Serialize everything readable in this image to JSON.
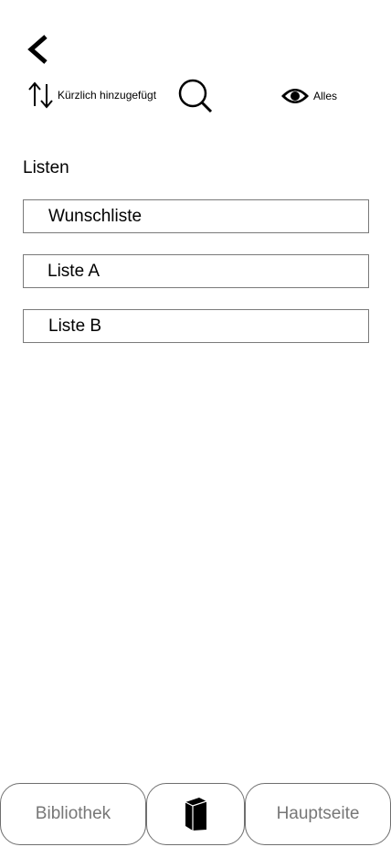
{
  "toolbar": {
    "sort_label": "Kürzlich hinzugefügt",
    "filter_label": "Alles"
  },
  "icons": {
    "back": "chevron-left-icon",
    "sort": "sort-arrows-icon",
    "search": "search-icon",
    "filter": "eye-icon",
    "book": "book-icon"
  },
  "section": {
    "title": "Listen"
  },
  "lists": [
    {
      "label": "Wunschliste"
    },
    {
      "label": "Liste A"
    },
    {
      "label": "Liste B"
    }
  ],
  "bottom_nav": {
    "library_label": "Bibliothek",
    "home_label": "Hauptseite"
  },
  "colors": {
    "border": "#7a7a7a",
    "nav_text": "#777777",
    "text": "#000000"
  }
}
